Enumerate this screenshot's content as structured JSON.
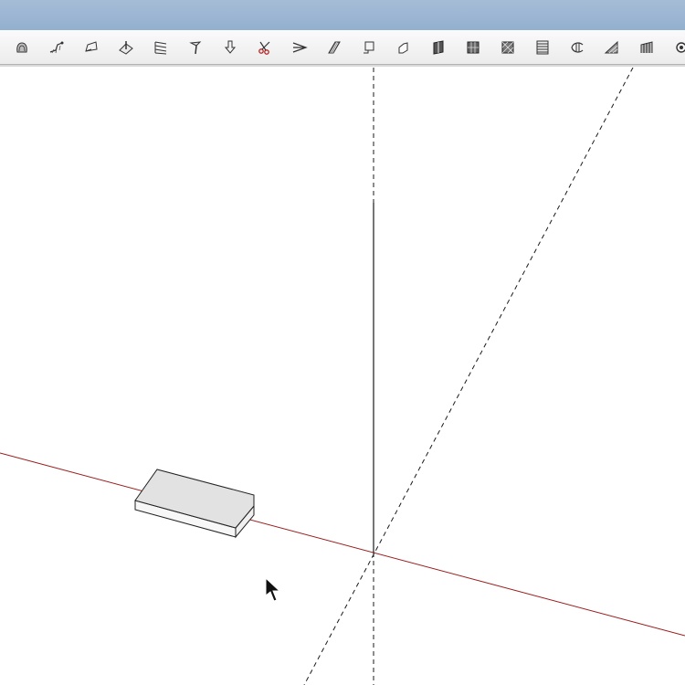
{
  "window": {
    "title": ""
  },
  "toolbar": {
    "tools": [
      {
        "name": "sandbox-from-contours"
      },
      {
        "name": "sandbox-from-scratch"
      },
      {
        "name": "smoove"
      },
      {
        "name": "stamp"
      },
      {
        "name": "drape"
      },
      {
        "name": "add-detail"
      },
      {
        "name": "flip-edge"
      },
      {
        "name": "scissors"
      },
      {
        "name": "tool-9"
      },
      {
        "name": "tool-10"
      },
      {
        "name": "tool-11"
      },
      {
        "name": "tool-12"
      },
      {
        "name": "tool-13"
      },
      {
        "name": "tool-14"
      },
      {
        "name": "tool-15"
      },
      {
        "name": "tool-16"
      },
      {
        "name": "tool-17"
      },
      {
        "name": "tool-18"
      },
      {
        "name": "tool-19"
      },
      {
        "name": "tool-20"
      }
    ]
  },
  "scene": {
    "axis_colors": {
      "red_axis": "#9b1c1c",
      "blue_axis": "#1a1a1a",
      "green_axis": "#1a1a1a"
    },
    "box_face_color": "#e2e2e2",
    "box_side_color": "#f7f7f7",
    "cursor": "arrow-cursor"
  }
}
